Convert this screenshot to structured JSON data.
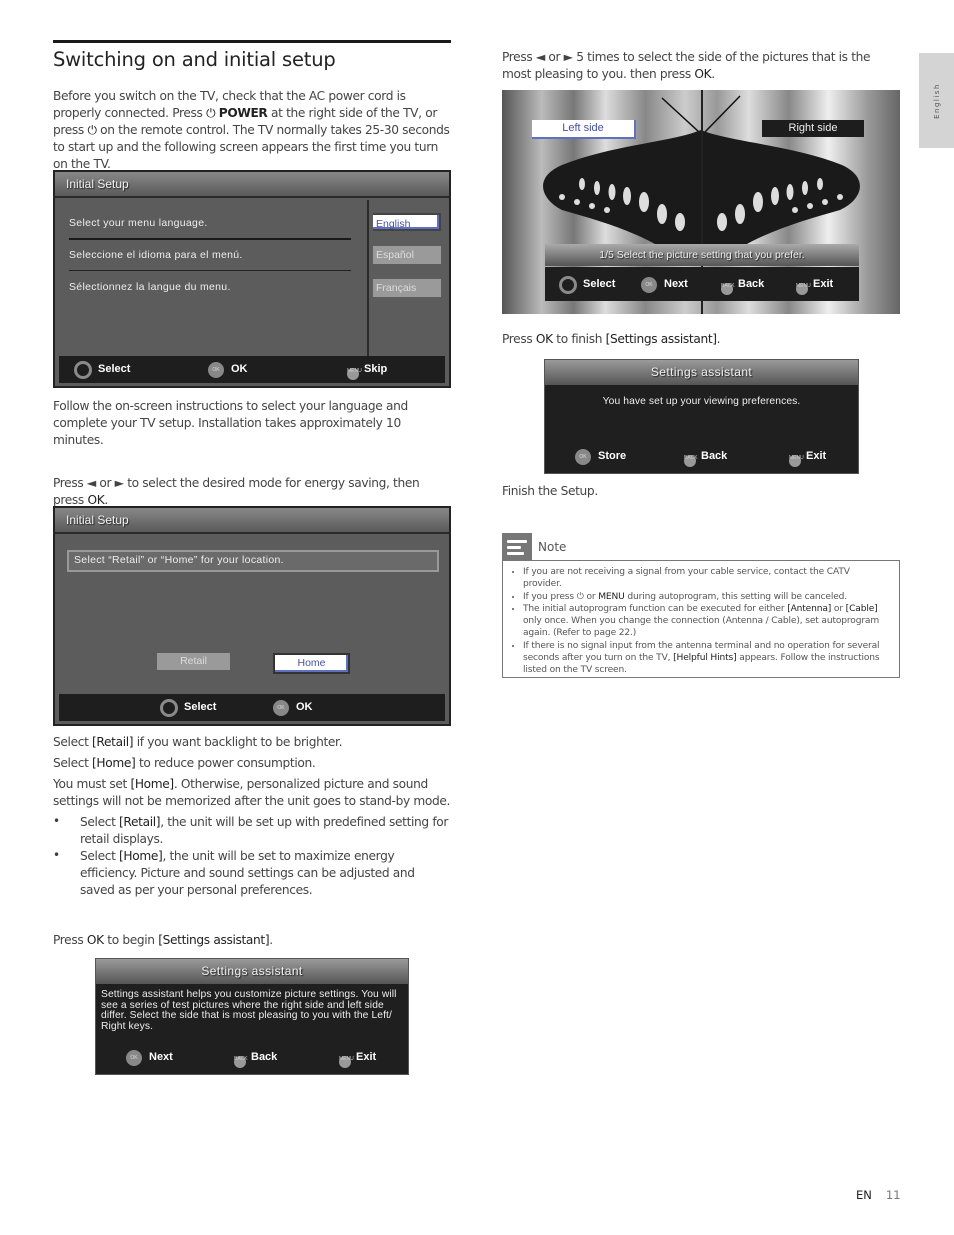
{
  "page": {
    "title": "Switching on and initial setup",
    "side_tab": "English",
    "footer_lang": "EN",
    "page_number": "11"
  },
  "left": {
    "intro": {
      "p1": "Before you switch on the TV, check that the AC power cord is properly connected. Press ",
      "power_label": "POWER",
      "p2": " at the right side of the TV, or press ",
      "p3": " on the remote control. The TV normally takes 25-30 seconds to start up and the following screen appears the first time you turn on the TV."
    },
    "follow": "Follow the on-screen instructions to select your language and complete your TV setup. Installation takes approximately 10 minutes.",
    "energy": {
      "pre": "Press ◄ or ► to select the desired mode for energy saving, then press ",
      "ok": "OK",
      "post": "."
    },
    "retail_line": {
      "pre": "Select ",
      "key": "[Retail]",
      "post": " if you want backlight to be brighter."
    },
    "home_line": {
      "pre": "Select ",
      "key": "[Home]",
      "post": " to reduce power consumption."
    },
    "must_line": {
      "pre": "You must set ",
      "key": "[Home]",
      "post": ". Otherwise, personalized picture and sound settings will not be memorized after the unit goes to stand-by mode."
    },
    "bullets": [
      {
        "pre": "Select ",
        "key": "[Retail]",
        "post": ", the unit will be set up with predefined setting for retail displays."
      },
      {
        "pre": "Select ",
        "key": "[Home]",
        "post": ", the unit will be set to maximize energy efficiency. Picture and sound settings can be adjusted and saved as per your personal preferences."
      }
    ],
    "begin": {
      "pre": "Press ",
      "ok": "OK",
      "mid": " to begin ",
      "key": "[Settings assistant]",
      "post": "."
    }
  },
  "screen_language": {
    "title": "Initial Setup",
    "prompts": [
      "Select your menu language.",
      "Seleccione el idioma para el menú.",
      "Sélectionnez la langue du menu."
    ],
    "options": [
      "English",
      "Español",
      "Français"
    ],
    "selected": "English",
    "footer": {
      "select": "Select",
      "ok_icon": "OK",
      "ok": "OK",
      "menu_tag": "MENU",
      "skip": "Skip"
    }
  },
  "screen_location": {
    "title": "Initial Setup",
    "prompt": "Select “Retail” or “Home” for your location.",
    "options": [
      "Retail",
      "Home"
    ],
    "selected": "Home",
    "footer": {
      "select": "Select",
      "ok_icon": "OK",
      "ok": "OK"
    }
  },
  "screen_assistant_intro": {
    "title": "Settings assistant",
    "body": "Settings assistant helps you customize picture settings. You will see a series of test pictures where the right side and left side differ. Select the side that is most pleasing to you with the Left/ Right keys.",
    "footer": {
      "ok_icon": "OK",
      "next": "Next",
      "back_tag": "BACK",
      "back": "Back",
      "menu_tag": "MENU",
      "exit": "Exit"
    }
  },
  "right": {
    "press_five": {
      "pre": "Press ◄ or ► 5 times to select the side of the pictures that is the most pleasing to you. then press ",
      "ok": "OK",
      "post": "."
    },
    "finish": {
      "pre": "Press ",
      "ok": "OK",
      "mid": " to finish ",
      "key": "[Settings assistant]",
      "post": "."
    },
    "finish_setup": "Finish the Setup."
  },
  "screen_picture": {
    "left_label": "Left side",
    "right_label": "Right side",
    "selected": "Left side",
    "hint": "1/5 Select the picture setting that you prefer.",
    "footer": {
      "select": "Select",
      "ok_icon": "OK",
      "next": "Next",
      "back_tag": "BACK",
      "back": "Back",
      "menu_tag": "MENU",
      "exit": "Exit"
    }
  },
  "screen_assistant_done": {
    "title": "Settings assistant",
    "body": "You have set up your viewing preferences.",
    "footer": {
      "ok_icon": "OK",
      "store": "Store",
      "back_tag": "BACK",
      "back": "Back",
      "menu_tag": "MENU",
      "exit": "Exit"
    }
  },
  "note": {
    "title": "Note",
    "items": [
      {
        "text": "If you are not receiving a signal from your cable service, contact the CATV provider."
      },
      {
        "pre": "If you press ",
        "mid": " or ",
        "key": "MENU",
        "post": " during autoprogram, this setting will be canceled."
      },
      {
        "pre": "The initial autoprogram function can be executed for either ",
        "k1": "[Antenna]",
        "mid": " or ",
        "k2": "[Cable]",
        "post": " only once. When you change the connection (Antenna / Cable), set autoprogram again. (Refer to page 22.)"
      },
      {
        "pre": "If there is no signal input from the antenna terminal and no operation for several seconds after you turn on the TV, ",
        "key": "[Helpful Hints]",
        "post": " appears. Follow the instructions listed on the TV screen."
      }
    ]
  }
}
